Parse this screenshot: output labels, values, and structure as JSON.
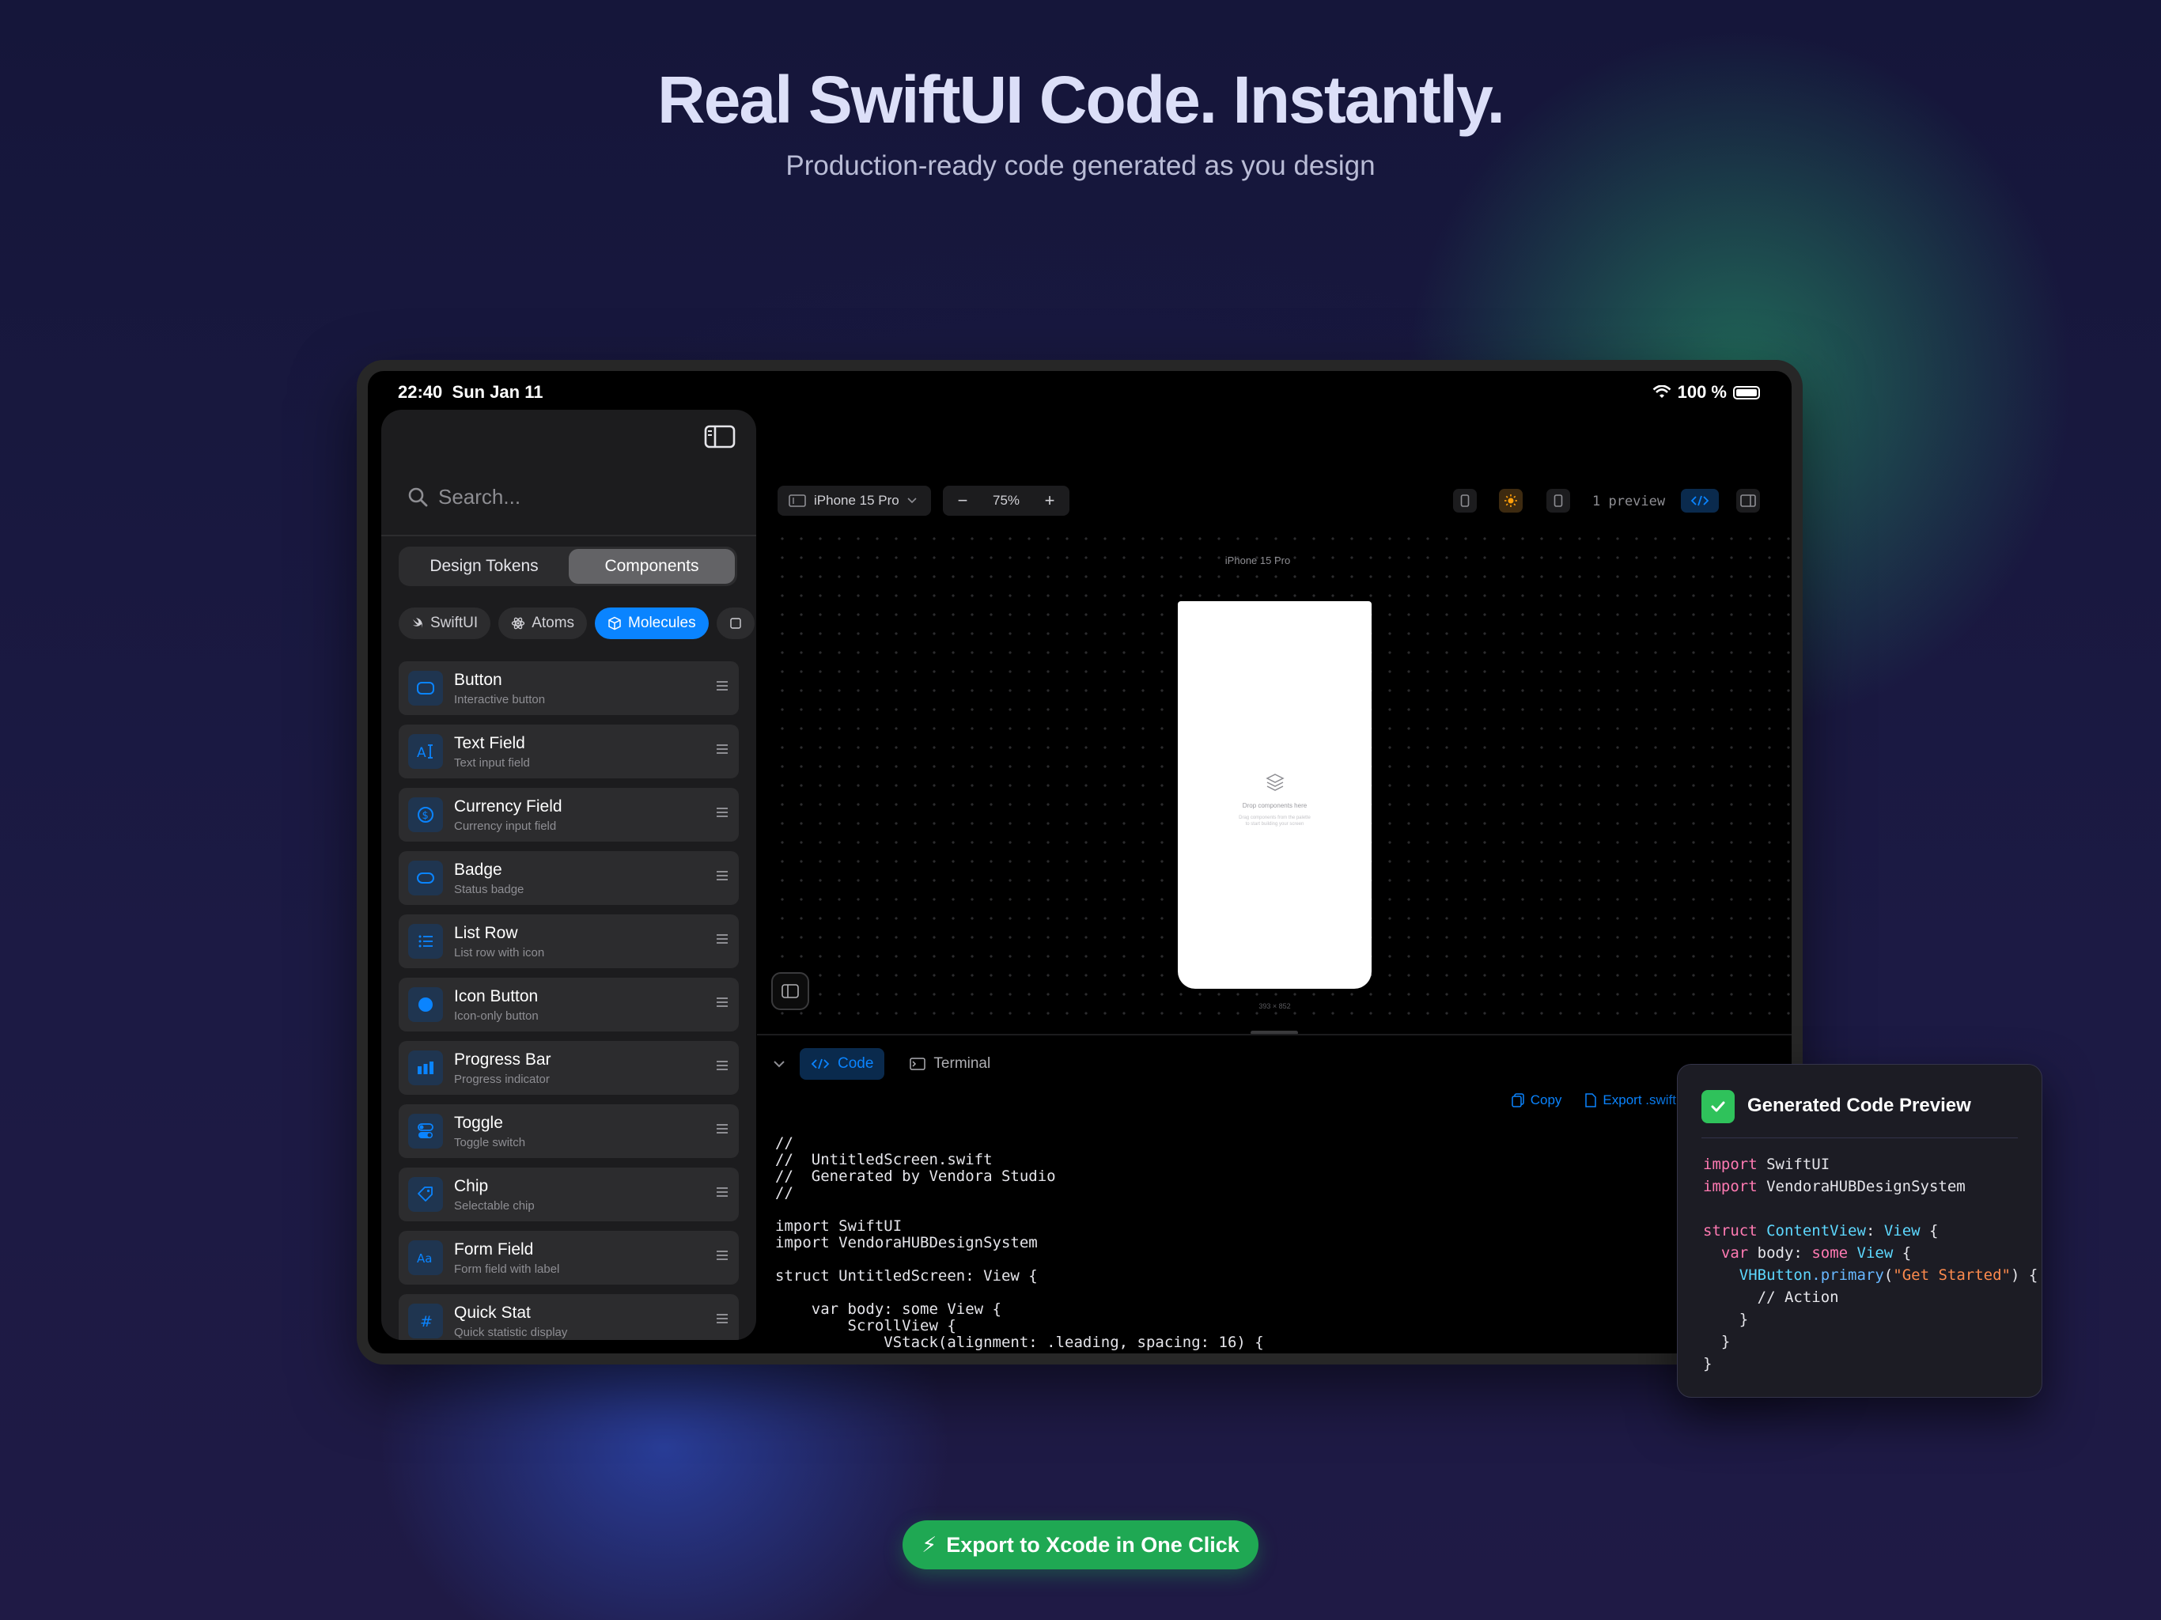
{
  "hero": {
    "title": "Real SwiftUI Code. Instantly.",
    "subtitle": "Production-ready code generated as you design"
  },
  "status_bar": {
    "time": "22:40",
    "date": "Sun Jan 11",
    "battery": "100 %"
  },
  "sidebar": {
    "search_placeholder": "Search...",
    "segments": [
      "Design Tokens",
      "Components"
    ],
    "selected_segment": "Components",
    "filters": [
      "SwiftUI",
      "Atoms",
      "Molecules"
    ],
    "selected_filter": "Molecules",
    "components": [
      {
        "name": "Button",
        "description": "Interactive button",
        "icon": "rounded-rect-icon"
      },
      {
        "name": "Text Field",
        "description": "Text input field",
        "icon": "text-cursor-icon"
      },
      {
        "name": "Currency Field",
        "description": "Currency input field",
        "icon": "dollar-circle-icon"
      },
      {
        "name": "Badge",
        "description": "Status badge",
        "icon": "capsule-icon"
      },
      {
        "name": "List Row",
        "description": "List row with icon",
        "icon": "list-icon"
      },
      {
        "name": "Icon Button",
        "description": "Icon-only button",
        "icon": "filled-circle-icon"
      },
      {
        "name": "Progress Bar",
        "description": "Progress indicator",
        "icon": "bar-chart-icon"
      },
      {
        "name": "Toggle",
        "description": "Toggle switch",
        "icon": "toggle-icon"
      },
      {
        "name": "Chip",
        "description": "Selectable chip",
        "icon": "tag-icon"
      },
      {
        "name": "Form Field",
        "description": "Form field with label",
        "icon": "text-format-icon"
      },
      {
        "name": "Quick Stat",
        "description": "Quick statistic display",
        "icon": "hash-icon"
      }
    ]
  },
  "toolbar": {
    "device": "iPhone 15 Pro",
    "zoom_out": "−",
    "zoom": "75%",
    "zoom_in": "+",
    "preview_count": "1 preview"
  },
  "canvas": {
    "device_label": "iPhone 15 Pro",
    "drop_title": "Drop components here",
    "drop_hint_line1": "Drag components from the palette",
    "drop_hint_line2": "to start building your screen",
    "size_label": "393 × 852"
  },
  "bottom_panel": {
    "tabs": [
      "Code",
      "Terminal"
    ],
    "active_tab": "Code",
    "actions": {
      "copy": "Copy",
      "export": "Export .swift"
    },
    "code_lines": [
      "//",
      "//  UntitledScreen.swift",
      "//  Generated by Vendora Studio",
      "//",
      "",
      "import SwiftUI",
      "import VendoraHUBDesignSystem",
      "",
      "struct UntitledScreen: View {",
      "",
      "    var body: some View {",
      "        ScrollView {",
      "            VStack(alignment: .leading, spacing: 16) {"
    ]
  },
  "popup": {
    "title": "Generated Code Preview",
    "code": {
      "import_kw": "import",
      "import1": "SwiftUI",
      "import2": "VendoraHUBDesignSystem",
      "struct_kw": "struct",
      "struct_name": "ContentView",
      "view_type": "View",
      "open_brace": "{",
      "var_kw": "var",
      "body_name": "body:",
      "some_kw": "some",
      "type_prefix": "VHButton",
      "method": ".primary",
      "string": "\"Get Started\"",
      "comment": "// Action",
      "close_brace": "}"
    }
  },
  "cta": {
    "icon": "⚡",
    "label": "Export to Xcode in One Click"
  },
  "colors": {
    "accent": "#0a84ff",
    "success": "#1fa853",
    "background": "#1b1a3c"
  }
}
